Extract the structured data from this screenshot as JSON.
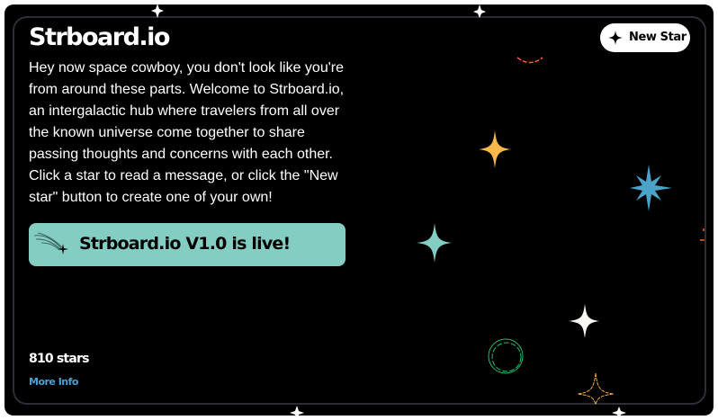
{
  "app": {
    "title": "Strboard.io"
  },
  "intro": "Hey now space cowboy, you don't look like you're from around these parts. Welcome to Strboard.io, an intergalactic hub where travelers from all over the known universe come together to share passing thoughts and concerns with each other. Click a star to read a message, or click the \"New star\" button to create one of your own!",
  "banner": {
    "text": "Strboard.io V1.0 is live!",
    "icon": "comet-icon",
    "color": "#83cdc3"
  },
  "new_star_button": {
    "label": "New Star",
    "icon": "sparkle-icon"
  },
  "stats": {
    "star_count": "810 stars"
  },
  "more_info": {
    "label": "More Info",
    "color": "#4aa3d6"
  },
  "stars": [
    {
      "kind": "sparkle",
      "color": "#f8b84a"
    },
    {
      "kind": "burst",
      "color": "#4aa3c8"
    },
    {
      "kind": "sparkle",
      "color": "#83cdc3"
    },
    {
      "kind": "sparkle",
      "color": "#faf7f2"
    },
    {
      "kind": "ring",
      "color": "#22c06a"
    },
    {
      "kind": "outline-sparkle",
      "color": "#f4a93a"
    },
    {
      "kind": "arc",
      "color": "#ff5a2a"
    }
  ]
}
